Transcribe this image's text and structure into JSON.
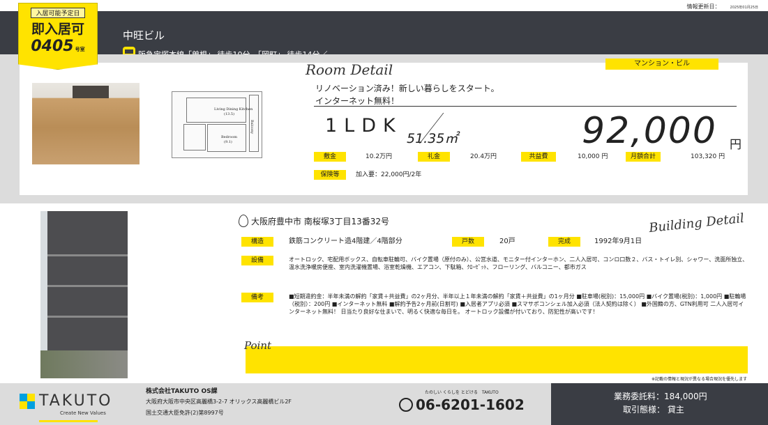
{
  "update": {
    "label": "情報更新日：",
    "date": "2025年01月25日"
  },
  "tag": {
    "caption": "入居可能予定日",
    "status": "即入居可",
    "room": "0405",
    "room_unit": "号室"
  },
  "header": {
    "building": "中旺ビル",
    "access": "阪急宝塚本線「曽根」 徒歩10分、「岡町」 徒歩14分／"
  },
  "room": {
    "heading": "Room Detail",
    "type": "マンション・ビル",
    "catch1": "リノベーション済み！新しい暮らしをスタート。",
    "catch2": "インターネット無料！",
    "layout": "1LDK",
    "area": "51.35㎡",
    "price": "92,000",
    "price_unit": "円"
  },
  "plan": {
    "ldk": "Living Dining Kitchen",
    "ldk_size": "(13.5)",
    "bed": "Bedroom",
    "bed_size": "(9.1)",
    "balcony": "Balcony"
  },
  "fees": [
    {
      "label": "敷金",
      "value": "10.2万円"
    },
    {
      "label": "礼金",
      "value": "20.4万円"
    },
    {
      "label": "共益費",
      "value": "10,000 円"
    },
    {
      "label": "月額合計",
      "value": "103,320 円"
    },
    {
      "label": "保険等",
      "value": "加入要：22,000円/2年"
    }
  ],
  "building": {
    "heading": "Building Detail",
    "address": "大阪府豊中市 南桜塚3丁目13番32号",
    "structure_label": "構造",
    "structure": "鉄筋コンクリート造4階建／4階部分",
    "units_label": "戸数",
    "units": "20戸",
    "built_label": "完成",
    "built": "1992年9月1日",
    "equip_label": "設備",
    "equip": "オートロック、宅配用ボックス、自転車駐輪可、バイク置場（原付のみ）、公営水道、モニター付インターホン、二人入居可、コンロ口数２、バス・トイレ別、シャワー、洗面所独立、温水洗浄暖房便座、室内洗濯機置場、浴室乾燥機、エアコン、下駄箱、ｸﾛｰｾﾞｯﾄ、フローリング、バルコニー、都市ガス",
    "remarks_label": "備考",
    "remarks": "■短期違約金：半年未満の解約「家賃＋共益費」の2ヶ月分、半年以上１年未満の解約「家賃＋共益費」の1ヶ月分 ■駐車場(税別)：15,000円 ■バイク置場(税別)：1,000円 ■駐輪場（税別）：200円 ■インターネット無料 ■解約予告2ヶ月前(日割可) ■入居者アプリ必須 ■スマサポコンシェル加入必須（法人契約は除く） ■外国籍の方、GTN利用可 二人入居可インターネット無料！ 日当たり良好な住まいで、明るく快適な毎日を。 オートロック設備が付いており、防犯性が高いです！",
    "point": "Point",
    "note": "※記載の情報と現況が異なる場合現況を優先します"
  },
  "footer": {
    "logo": "TAKUTO",
    "tagline": "Create New Values",
    "company": "株式会社TAKUTO OS課",
    "address": "大阪府大阪市中央区高麗橋3-2-7 オリックス高麗橋ビル2F",
    "license": "国土交通大臣免許(2)第8997号",
    "slogan": "たのしい くらしを とどける　TAKUTO",
    "tel": "06-6201-1602",
    "fee": "業務委託料：184,000円",
    "deal": "取引態様： 貸主"
  },
  "colors": {
    "accent": "#ffe300",
    "dark": "#3a3d44"
  }
}
